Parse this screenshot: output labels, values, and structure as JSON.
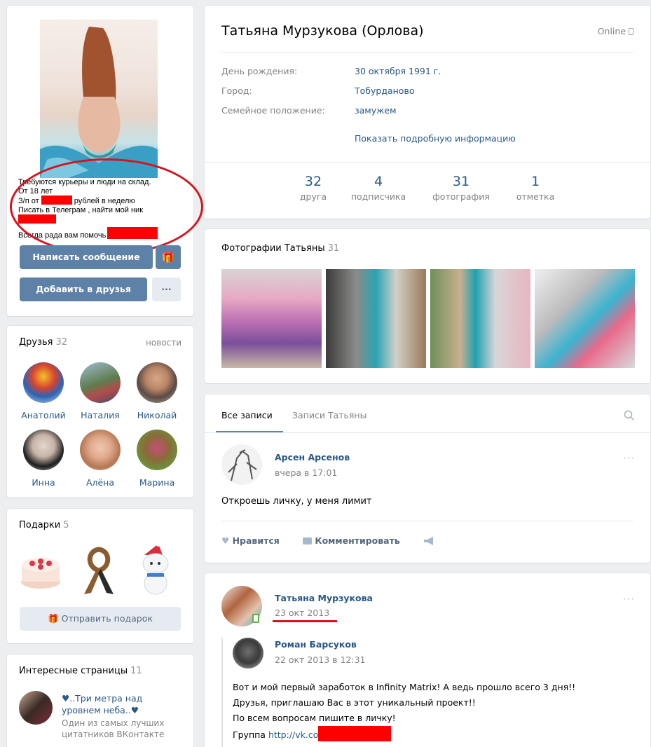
{
  "profile": {
    "name": "Татьяна Мурзукова (Орлова)",
    "status": "Online",
    "info": [
      {
        "label": "День рождения:",
        "value": "30 октября 1991 г."
      },
      {
        "label": "Город:",
        "value": "Тобурданово"
      },
      {
        "label": "Семейное положение:",
        "value": "замужем"
      }
    ],
    "more_link": "Показать подробную информацию",
    "counters": [
      {
        "num": "32",
        "label": "друга"
      },
      {
        "num": "4",
        "label": "подписчика"
      },
      {
        "num": "31",
        "label": "фотография"
      },
      {
        "num": "1",
        "label": "отметка"
      }
    ]
  },
  "avatar_ad": {
    "line1": "Требуются курьеры и люди на склад.",
    "line2": "От 18 лет",
    "line3a": "З/п от",
    "line3b": "рублей в неделю",
    "line4": "Писать в Телеграм , найти мой ник",
    "line6": "Всегда рада вам помочь"
  },
  "buttons": {
    "message": "Написать сообщение",
    "add_friend": "Добавить в друзья",
    "more": "···"
  },
  "friends": {
    "title": "Друзья",
    "count": "32",
    "news": "новости",
    "items": [
      "Анатолий",
      "Наталия",
      "Николай",
      "Инна",
      "Алёна",
      "Марина"
    ]
  },
  "gifts": {
    "title": "Подарки",
    "count": "5",
    "send": "Отправить подарок"
  },
  "interesting": {
    "title": "Интересные страницы",
    "count": "11",
    "page_name": "♥..Три метра над уровнем неба..♥",
    "page_desc": "Один из самых лучших цитатников ВКонтакте"
  },
  "photos": {
    "title": "Фотографии Татьяны",
    "count": "31"
  },
  "wall": {
    "tab_all": "Все записи",
    "tab_own": "Записи Татьяны"
  },
  "post1": {
    "author": "Арсен Арсенов",
    "time": "вчера в 17:01",
    "text": "Откроешь личку, у меня лимит",
    "like": "Нравится",
    "comment": "Комментировать"
  },
  "post2": {
    "author": "Татьяна Мурзукова",
    "date": "23 окт 2013",
    "repost_author": "Роман Барсуков",
    "repost_time": "22 окт 2013 в 12:31",
    "lines": [
      "Вот и мой первый заработок в Infinity Matrix! А ведь прошло всего 3 дня!!",
      "Друзья, приглашаю Вас в этот уникальный проект!!",
      "По всем вопросам пишите в личку!"
    ],
    "group_label": "Группа",
    "group_link": "http://vk.co"
  },
  "colors": {
    "link": "#2a5885",
    "button": "#5e81a8",
    "redaction": "#ff0000",
    "annotation": "#d6141f",
    "background": "#edeef0"
  }
}
